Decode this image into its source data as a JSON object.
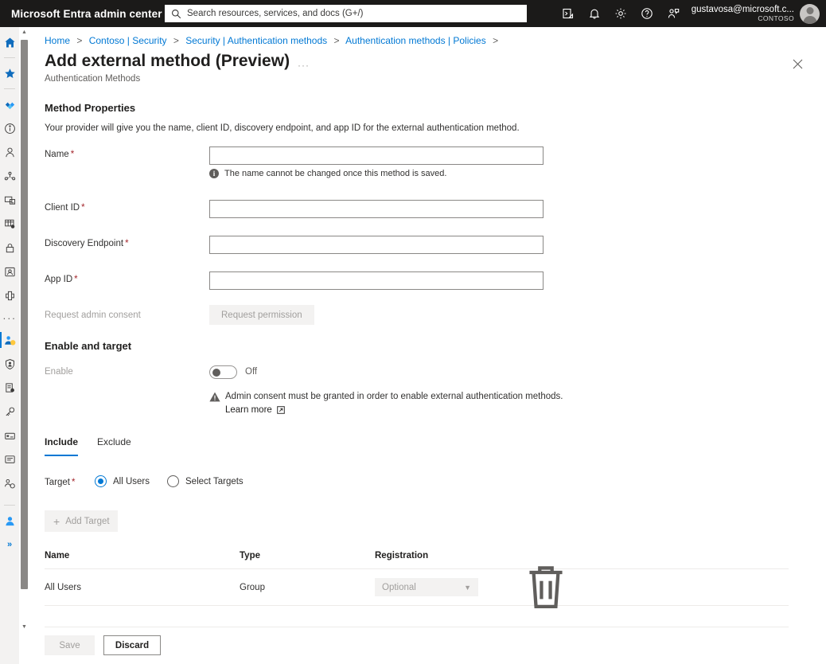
{
  "topbar": {
    "brand": "Microsoft Entra admin center",
    "search_placeholder": "Search resources, services, and docs (G+/)",
    "icons": [
      {
        "name": "cloud-shell-icon",
        "glyph": "cloud-shell"
      },
      {
        "name": "notifications-bell-icon",
        "glyph": "bell"
      },
      {
        "name": "settings-gear-icon",
        "glyph": "gear"
      },
      {
        "name": "help-question-icon",
        "glyph": "question"
      },
      {
        "name": "feedback-icon",
        "glyph": "feedback"
      }
    ],
    "account_name": "gustavosa@microsoft.c...",
    "account_org": "CONTOSO"
  },
  "rail": {
    "items": [
      {
        "name": "home-icon",
        "selected": false
      },
      {
        "name": "favorites-star-icon",
        "selected": false
      },
      {
        "name": "entra-diamond-icon",
        "selected": false
      },
      {
        "name": "overview-info-icon",
        "selected": false
      },
      {
        "name": "users-person-icon",
        "selected": false
      },
      {
        "name": "groups-icon",
        "selected": false
      },
      {
        "name": "devices-icon",
        "selected": false
      },
      {
        "name": "applications-grid-icon",
        "selected": false
      },
      {
        "name": "protection-lock-icon",
        "selected": false
      },
      {
        "name": "identity-governance-icon",
        "selected": false
      },
      {
        "name": "verified-id-icon",
        "selected": false
      },
      {
        "name": "more-ellipsis-icon",
        "selected": false
      },
      {
        "name": "identity-person-badge-icon",
        "selected": true
      },
      {
        "name": "protection-shield-person-icon",
        "selected": false
      },
      {
        "name": "reports-document-icon",
        "selected": false
      },
      {
        "name": "permissions-key-icon",
        "selected": false
      },
      {
        "name": "billing-card-icon",
        "selected": false
      },
      {
        "name": "support-chat-icon",
        "selected": false
      },
      {
        "name": "roles-admins-icon",
        "selected": false
      }
    ],
    "bottom_items": [
      {
        "name": "user-settings-icon"
      },
      {
        "name": "expand-chevron-icon",
        "label": "»"
      }
    ]
  },
  "breadcrumb": {
    "items": [
      "Home",
      "Contoso | Security",
      "Security | Authentication methods",
      "Authentication methods | Policies"
    ],
    "separator": ">"
  },
  "page": {
    "title": "Add external method (Preview)",
    "ellipsis": "···",
    "subtitle": "Authentication Methods",
    "close_label": "close-icon"
  },
  "method_properties": {
    "heading": "Method Properties",
    "lead": "Your provider will give you the name, client ID, discovery endpoint, and app ID for the external authentication method.",
    "fields": [
      {
        "label": "Name",
        "required": true,
        "value": "",
        "placeholder": "",
        "helper": "The name cannot be changed once this method is saved."
      },
      {
        "label": "Client ID",
        "required": true,
        "value": "",
        "placeholder": "",
        "helper": ""
      },
      {
        "label": "Discovery Endpoint",
        "required": true,
        "value": "",
        "placeholder": "",
        "helper": ""
      },
      {
        "label": "App ID",
        "required": true,
        "value": "",
        "placeholder": "",
        "helper": ""
      }
    ],
    "consent_label": "Request admin consent",
    "consent_button": "Request permission"
  },
  "enable_and_target": {
    "heading": "Enable and target",
    "enable_label": "Enable",
    "toggle_state": "Off",
    "warning_text": "Admin consent must be granted in order to enable external authentication methods.",
    "learn_more": "Learn more",
    "tabs": [
      {
        "label": "Include",
        "active": true
      },
      {
        "label": "Exclude",
        "active": false
      }
    ],
    "target_label": "Target",
    "target_required": true,
    "radios": [
      {
        "label": "All Users",
        "selected": true
      },
      {
        "label": "Select Targets",
        "selected": false
      }
    ],
    "add_target_button": "Add Target",
    "add_target_plus": "+"
  },
  "table": {
    "columns": [
      "Name",
      "Type",
      "Registration"
    ],
    "rows": [
      {
        "name": "All Users",
        "type": "Group",
        "registration": "Optional",
        "chevron": "⌄",
        "delete_icon": "trash-icon"
      }
    ]
  },
  "footer": {
    "save_label": "Save",
    "discard_label": "Discard"
  },
  "colors": {
    "accent": "#0078d4",
    "topbar_bg": "#1b1a19",
    "required_asterisk": "#a4262c",
    "rail_bg": "#f3f2f1",
    "disabled_text": "#a19f9d"
  }
}
